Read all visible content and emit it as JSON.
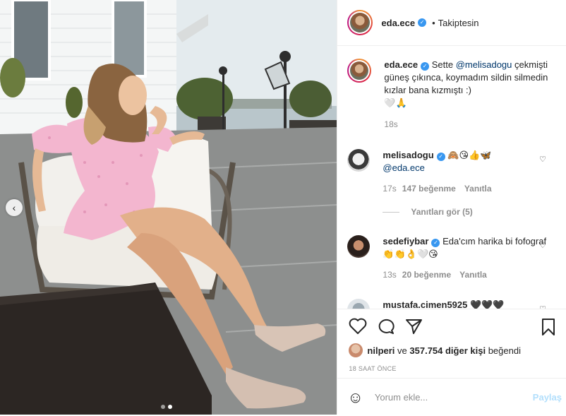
{
  "photo": {
    "prev_button": "‹",
    "carousel_dots": 2,
    "active_dot": 1
  },
  "header": {
    "username": "eda.ece",
    "separator": "•",
    "follow_status": "Takiptesin"
  },
  "caption": {
    "username": "eda.ece",
    "text_before": "Sette ",
    "mention": "@melisadogu",
    "text_after": "çekmişti güneş çıkınca, koymadım sildin silmedin kızlar bana kızmıştı :)",
    "emoji": "🤍🙏",
    "time": "18s"
  },
  "comments": [
    {
      "username": "melisadogu",
      "emoji": "🙈😘👍🦋",
      "mention": "@eda.ece",
      "time": "17s",
      "likes": "147 beğenme",
      "reply": "Yanıtla",
      "view_replies": "Yanıtları gör (5)"
    },
    {
      "username": "sedefiybar",
      "text": "Eda'cım harika bi fofograf 👏👏👌🤍😘",
      "time": "13s",
      "likes": "20 beğenme",
      "reply": "Yanıtla"
    },
    {
      "username": "mustafa.cimen5925",
      "text": "🖤🖤🖤"
    }
  ],
  "likes": {
    "liker": "nilperi",
    "connector": " ve ",
    "others": "357.754 diğer kişi",
    "suffix": " beğendi"
  },
  "time_ago": "18 SAAT ÖNCE",
  "add_comment": {
    "emoji_icon": "☺",
    "placeholder": "Yorum ekle...",
    "post_label": "Paylaş"
  },
  "colors": {
    "verified": "#3897f0",
    "mention": "#00376b",
    "post_disabled": "#b2dffc",
    "dress": "#f3b6cf"
  }
}
